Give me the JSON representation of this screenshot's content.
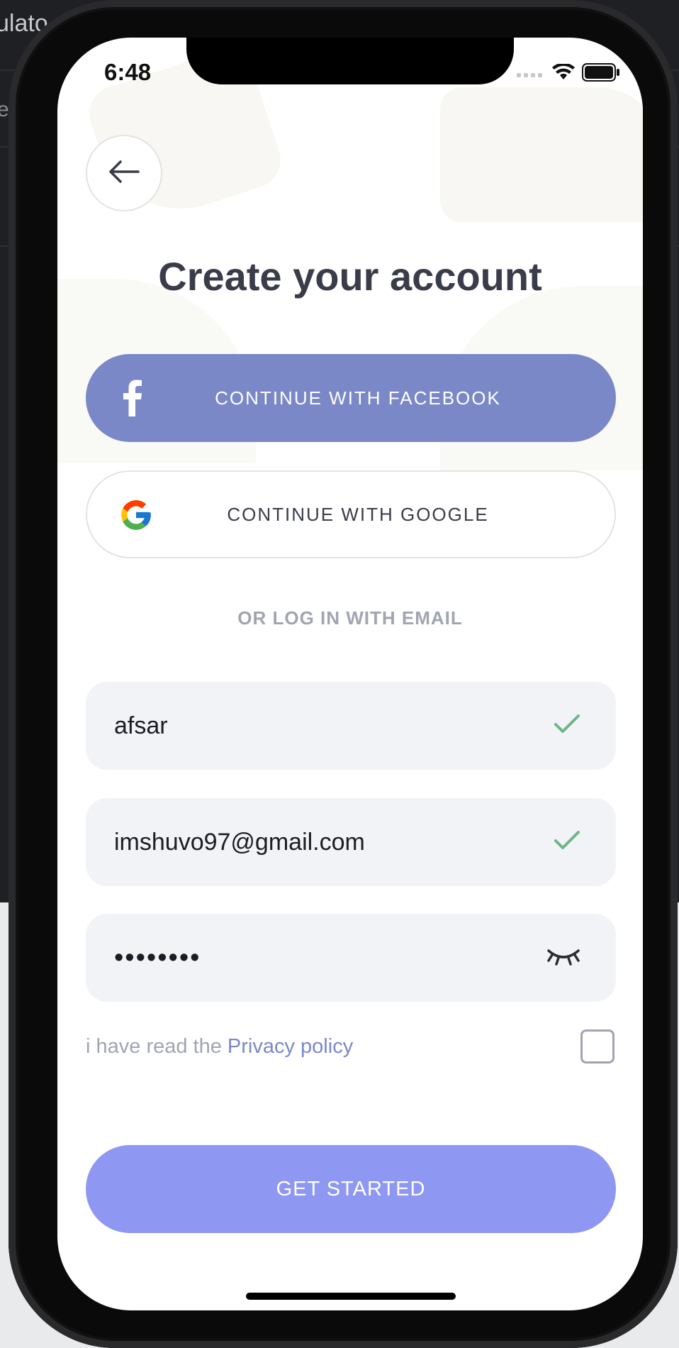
{
  "simulator": {
    "title_fragment": "ulato",
    "sub_fragment": "e"
  },
  "status_bar": {
    "time": "6:48",
    "icons": [
      "cellular-signal-icon",
      "wifi-icon",
      "battery-icon"
    ]
  },
  "header": {
    "back_icon": "arrow-left-icon",
    "title": "Create your account"
  },
  "social": {
    "facebook_label": "CONTINUE WITH FACEBOOK",
    "facebook_icon": "facebook-f-icon",
    "google_label": "CONTINUE WITH GOOGLE",
    "google_icon": "google-g-icon"
  },
  "divider_text": "OR LOG IN WITH EMAIL",
  "form": {
    "name_value": "afsar",
    "email_value": "imshuvo97@gmail.com",
    "password_value": "••••••••",
    "name_status_icon": "check-icon",
    "email_status_icon": "check-icon",
    "password_toggle_icon": "eye-closed-icon"
  },
  "privacy": {
    "text": "i have read the ",
    "link": "Privacy policy",
    "checked": false
  },
  "submit_label": "GET STARTED",
  "colors": {
    "facebook": "#7b88c8",
    "primary_button": "#8e97f2",
    "title": "#3a3c4a",
    "muted": "#a1a4b2",
    "field_bg": "#f2f3f7",
    "check": "#6fb48a"
  }
}
